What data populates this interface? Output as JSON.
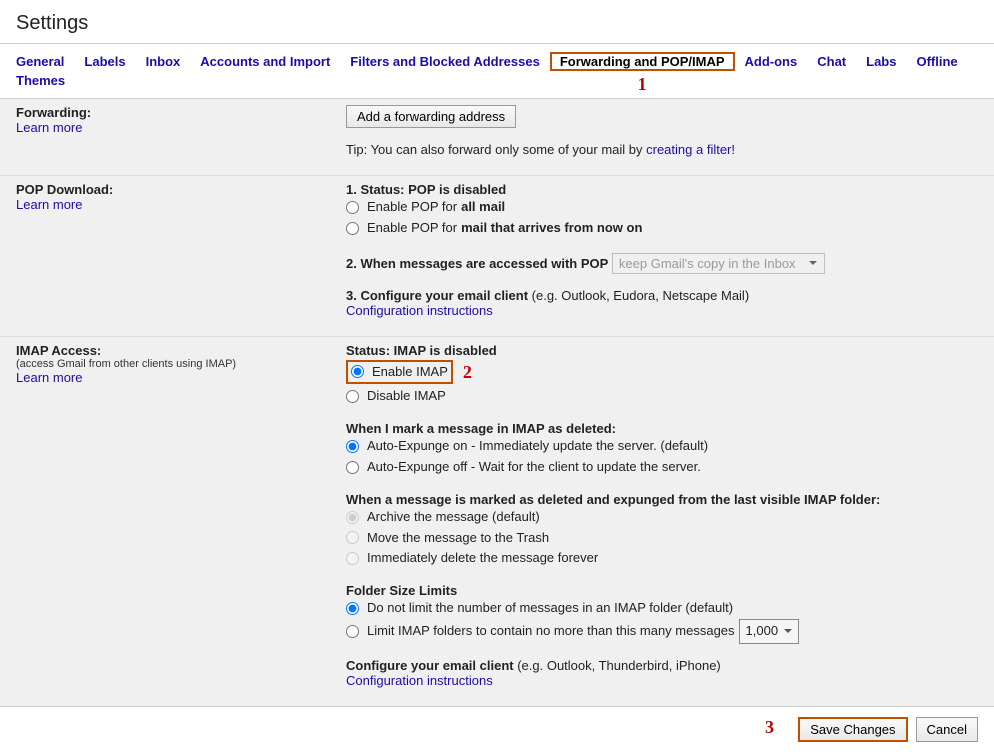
{
  "title": "Settings",
  "tabs": [
    "General",
    "Labels",
    "Inbox",
    "Accounts and Import",
    "Filters and Blocked Addresses",
    "Forwarding and POP/IMAP",
    "Add-ons",
    "Chat",
    "Labs",
    "Offline",
    "Themes"
  ],
  "activeTab": "Forwarding and POP/IMAP",
  "annot": {
    "tab": "1",
    "imap": "2",
    "save": "3"
  },
  "forwarding": {
    "label": "Forwarding:",
    "learn": "Learn more",
    "button": "Add a forwarding address",
    "tip_pre": "Tip: You can also forward only some of your mail by ",
    "tip_link": "creating a filter!"
  },
  "pop": {
    "label": "POP Download:",
    "learn": "Learn more",
    "s1_pre": "1. Status: ",
    "s1_bold": "POP is disabled",
    "r1_pre": "Enable POP for ",
    "r1_bold": "all mail",
    "r2_pre": "Enable POP for ",
    "r2_bold": "mail that arrives from now on",
    "s2": "2. When messages are accessed with POP",
    "s2_sel": "keep Gmail's copy in the Inbox",
    "s3_bold": "3. Configure your email client",
    "s3_rest": " (e.g. Outlook, Eudora, Netscape Mail)",
    "s3_link": "Configuration instructions"
  },
  "imap": {
    "label": "IMAP Access:",
    "sub": "(access Gmail from other clients using IMAP)",
    "learn": "Learn more",
    "status_pre": "Status: ",
    "status_bold": "IMAP is disabled",
    "enable": "Enable IMAP",
    "disable": "Disable IMAP",
    "del_h": "When I mark a message in IMAP as deleted:",
    "del_r1": "Auto-Expunge on - Immediately update the server. (default)",
    "del_r2": "Auto-Expunge off - Wait for the client to update the server.",
    "exp_h": "When a message is marked as deleted and expunged from the last visible IMAP folder:",
    "exp_r1": "Archive the message (default)",
    "exp_r2": "Move the message to the Trash",
    "exp_r3": "Immediately delete the message forever",
    "fsl_h": "Folder Size Limits",
    "fsl_r1": "Do not limit the number of messages in an IMAP folder (default)",
    "fsl_r2": "Limit IMAP folders to contain no more than this many messages",
    "fsl_num": "1,000",
    "conf_bold": "Configure your email client",
    "conf_rest": " (e.g. Outlook, Thunderbird, iPhone)",
    "conf_link": "Configuration instructions"
  },
  "footer": {
    "save": "Save Changes",
    "cancel": "Cancel"
  }
}
